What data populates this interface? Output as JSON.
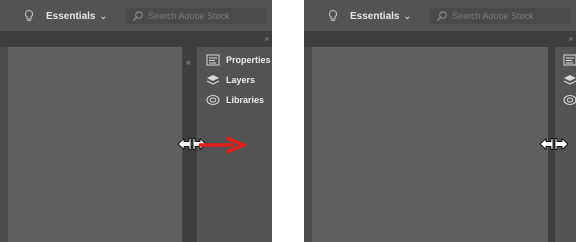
{
  "toolbar": {
    "workspace_label": "Essentials",
    "workspace_chevron": "⌄",
    "search_placeholder": "Search Adobe Stock"
  },
  "dock": {
    "items": [
      {
        "label": "Properties",
        "icon": "properties-icon"
      },
      {
        "label": "Layers",
        "icon": "layers-icon"
      },
      {
        "label": "Libraries",
        "icon": "libraries-icon"
      }
    ]
  },
  "colors": {
    "app_bg": "#4a4a4a",
    "topbar": "#535353",
    "canvas": "#5f5f5f",
    "dock": "#535353",
    "arrow": "#e0201c"
  }
}
